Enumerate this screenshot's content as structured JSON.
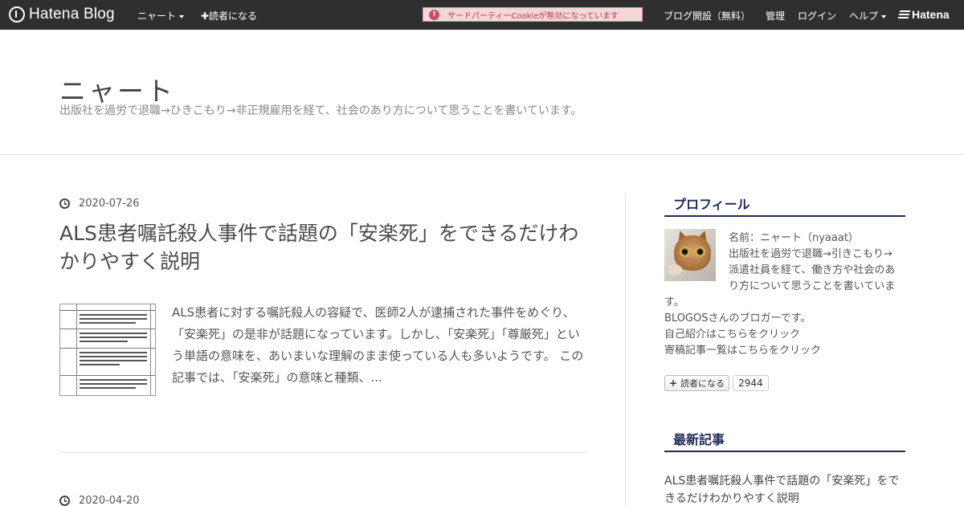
{
  "globalbar": {
    "logo_text": "Hatena Blog",
    "blog_menu_label": "ニャート",
    "subscribe_label": "✚読者になる",
    "cookie_warning": "サードパーティーCookieが無効になっています",
    "open_blog_label": "ブログ開設（無料）",
    "admin_label": "管理",
    "login_label": "ログイン",
    "help_label": "ヘルプ",
    "brand_label": "Hatena"
  },
  "blog": {
    "title": "ニャート",
    "description": "出版社を過労で退職→ひきこもり→非正規雇用を経て、社会のあり方について思うことを書いています。"
  },
  "entries": [
    {
      "date": "2020-07-26",
      "title": "ALS患者嘱託殺人事件で話題の「安楽死」をできるだけわかりやすく説明",
      "summary": "ALS患者に対する嘱託殺人の容疑で、医師2人が逮捕された事件をめぐり、「安楽死」の是非が話題になっています。しかし、「安楽死」「尊厳死」という単語の意味を、あいまいな理解のまま使っている人も多いようです。 この記事では、「安楽死」の意味と種類、..."
    },
    {
      "date": "2020-04-20"
    }
  ],
  "sidebar": {
    "profile": {
      "title": "プロフィール",
      "name_line": "名前：ニャート（nyaaat）",
      "bio_line1": "出版社を過労で退職→引きこもり→",
      "bio_line2": "派遣社員を経て、働き方や社会のあ",
      "bio_line3": "り方について思うことを書いていま",
      "bio_line4": "す。",
      "blogos_line": "BLOGOSさんのブロガーです。",
      "intro_link": "自己紹介はこちらをクリック",
      "contrib_link": "寄稿記事一覧はこちらをクリック",
      "reader_button": "読者になる",
      "reader_count": "2944"
    },
    "recent": {
      "title": "最新記事",
      "item1": "ALS患者嘱託殺人事件で話題の「安楽死」をできるだけわかりやすく説明"
    }
  }
}
